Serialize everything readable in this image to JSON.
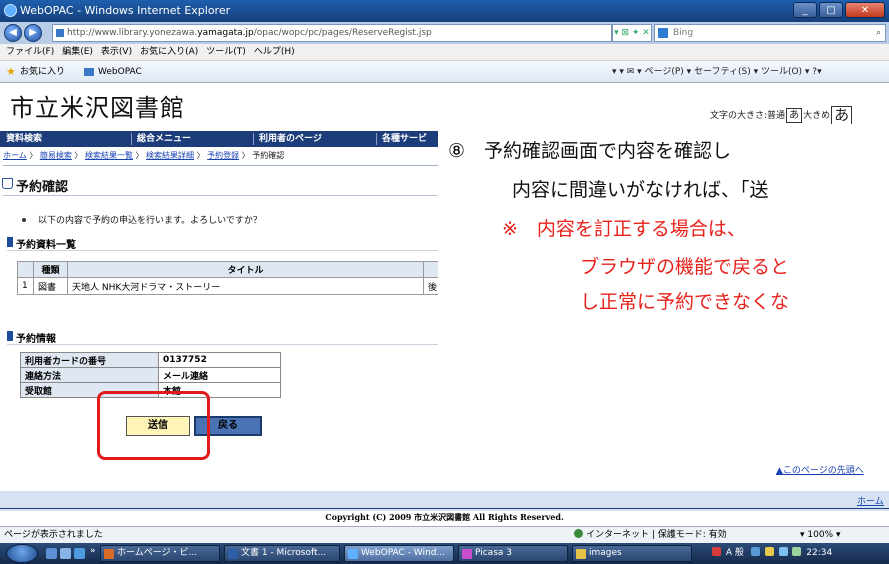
{
  "window": {
    "title": "WebOPAC - Windows Internet Explorer",
    "url_prefix": "http://www.library.yonezawa.",
    "url_domain": "yamagata.jp",
    "url_suffix": "/opac/wopc/pc/pages/ReserveRegist.jsp",
    "search_placeholder": "Bing",
    "address_tools": "▾ ⊠ ✦ ✕"
  },
  "menu": [
    "ファイル(F)",
    "編集(E)",
    "表示(V)",
    "お気に入り(A)",
    "ツール(T)",
    "ヘルプ(H)"
  ],
  "favorites": {
    "label": "お気に入り",
    "tab": "WebOPAC",
    "command_bar": "▾ ▾ ✉ ▾ ページ(P) ▾ セーフティ(S) ▾ ツール(O) ▾ ?▾"
  },
  "header": {
    "site_title": "市立米沢図書館",
    "font_size_label": "文字の大きさ:",
    "normal_label": "普通",
    "normal_box": "あ",
    "large_label": "大きめ",
    "large_box": "あ"
  },
  "nav_tabs": [
    "資料検索",
    "総合メニュー",
    "利用者のページ",
    "各種サービ"
  ],
  "breadcrumb": {
    "items": [
      "ホーム",
      "簡易検索",
      "検索結果一覧",
      "検索結果詳細",
      "予約登録"
    ],
    "separator": "〉",
    "current": "予約確認"
  },
  "page": {
    "heading": "予約確認",
    "question": "以下の内容で予約の申込を行います。よろしいですか？",
    "materials_section": "予約資料一覧",
    "materials_headers": [
      "",
      "種類",
      "タイトル",
      ""
    ],
    "materials_rows": [
      {
        "no": "1",
        "type": "図書",
        "title": "天地人 NHK大河ドラマ・ストーリー",
        "extra": "後"
      }
    ],
    "info_section": "予約情報",
    "info_rows": [
      {
        "label": "利用者カードの番号",
        "value": "0137752"
      },
      {
        "label": "連絡方法",
        "value": "メール連絡"
      },
      {
        "label": "受取館",
        "value": "本館"
      }
    ],
    "send_button": "送信",
    "back_button": "戻る",
    "to_top_link": "▲このページの先頭へ"
  },
  "footer": {
    "home_link": "ホーム",
    "copyright_prefix": "Copyright (C) 2009 ",
    "copyright_name": "市立米沢図書館",
    "copyright_suffix": " All Rights Reserved."
  },
  "status_bar": {
    "left": "ページが表示されました",
    "zone": "インターネット | 保護モード: 有効",
    "zoom": "▾ 100% ▾"
  },
  "taskbar": {
    "tasks": [
      "ホームページ・ビ...",
      "文書 1 - Microsoft...",
      "WebOPAC - Wind...",
      "Picasa 3",
      "images"
    ],
    "tray_text": "A 般",
    "clock": "22:34"
  },
  "overlay": {
    "line1": "⑧　予約確認画面で内容を確認し",
    "line2": "内容に間違いがなければ、「送",
    "line3": "※　内容を訂正する場合は、",
    "line4": "ブラウザの機能で戻ると",
    "line5": "し正常に予約できなくな"
  },
  "colors": {
    "nav_bar": "#1d3d7a",
    "highlight": "#e11b1b",
    "send_button": "#fff4b8",
    "back_button": "#4a73b5",
    "overlay_red": "#e8221b"
  }
}
